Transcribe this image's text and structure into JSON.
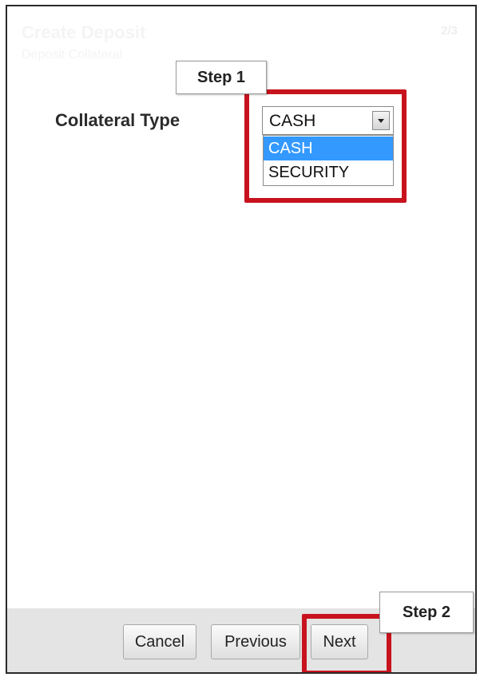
{
  "header": {
    "title": "Create Deposit",
    "subtitle": "Deposit Collateral",
    "page": "2/3"
  },
  "form": {
    "collateral_label": "Collateral Type",
    "collateral_value": "CASH",
    "collateral_options": [
      "CASH",
      "SECURITY"
    ],
    "selected_option": "CASH"
  },
  "annotations": {
    "step1": "Step 1",
    "step2": "Step 2",
    "highlight_color": "#c8131e"
  },
  "buttons": {
    "cancel": "Cancel",
    "previous": "Previous",
    "next": "Next"
  },
  "colors": {
    "selection_bg": "#3399ff",
    "footer_bg": "#e4e4e4"
  }
}
